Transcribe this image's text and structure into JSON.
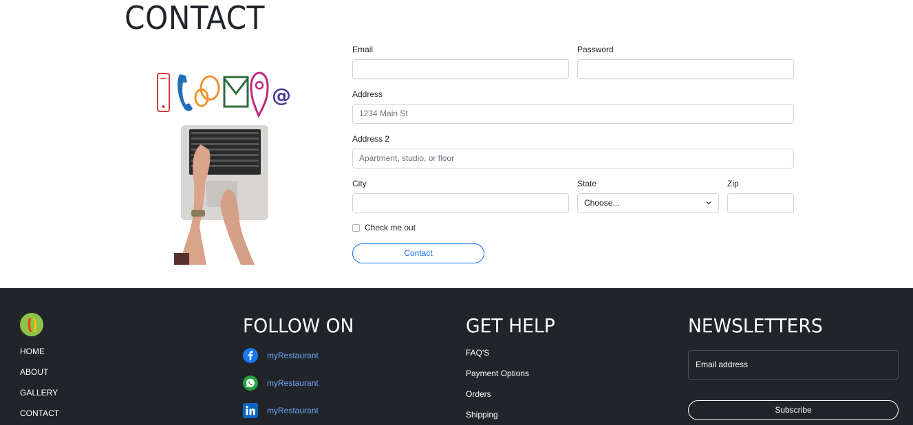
{
  "page": {
    "title": "CONTACT"
  },
  "form": {
    "email_label": "Email",
    "password_label": "Password",
    "address_label": "Address",
    "address_placeholder": "1234 Main St",
    "address2_label": "Address 2",
    "address2_placeholder": "Apartment, studio, or floor",
    "city_label": "City",
    "state_label": "State",
    "state_value": "Choose...",
    "zip_label": "Zip",
    "checkbox_label": "Check me out",
    "submit_label": "Contact"
  },
  "footer": {
    "nav": [
      "HOME",
      "ABOUT",
      "GALLERY",
      "CONTACT"
    ],
    "follow_heading": "FOLLOW ON",
    "social": [
      {
        "icon": "facebook-icon",
        "label": "myRestaurant"
      },
      {
        "icon": "whatsapp-icon",
        "label": "myRestaurant"
      },
      {
        "icon": "linkedin-icon",
        "label": "myRestaurant"
      }
    ],
    "help_heading": "GET HELP",
    "help_links": [
      "FAQ'S",
      "Payment Options",
      "Orders",
      "Shipping"
    ],
    "newsletter_heading": "NEWSLETTERS",
    "newsletter_placeholder": "Email address",
    "subscribe_label": "Subscribe"
  },
  "colors": {
    "accent": "#0d6efd",
    "footer_bg": "#212529",
    "link": "#6ea8fe"
  }
}
